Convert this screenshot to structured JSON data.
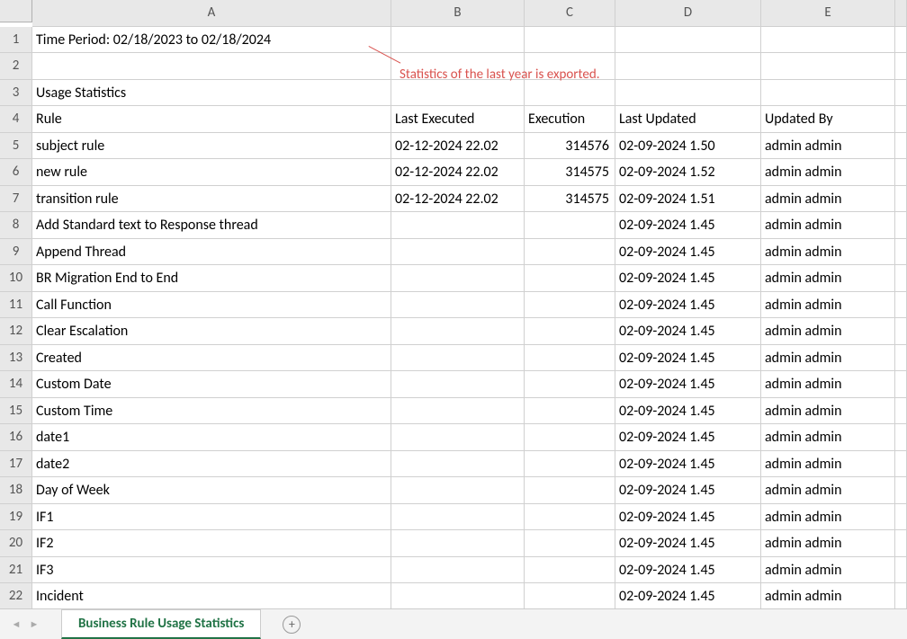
{
  "columns": [
    "A",
    "B",
    "C",
    "D",
    "E"
  ],
  "annotation": "Statistics of the last year is exported.",
  "time_period": "Time Period: 02/18/2023 to 02/18/2024",
  "section_title": "Usage Statistics",
  "headers": {
    "rule": "Rule",
    "last_executed": "Last Executed",
    "execution": "Execution",
    "last_updated": "Last Updated",
    "updated_by": "Updated By"
  },
  "rows": [
    {
      "n": "5",
      "rule": "subject rule",
      "last_executed": "02-12-2024 22.02",
      "execution": "314576",
      "last_updated": "02-09-2024 1.50",
      "updated_by": "admin admin"
    },
    {
      "n": "6",
      "rule": "new rule",
      "last_executed": "02-12-2024 22.02",
      "execution": "314575",
      "last_updated": "02-09-2024 1.52",
      "updated_by": "admin admin"
    },
    {
      "n": "7",
      "rule": "transition rule",
      "last_executed": "02-12-2024 22.02",
      "execution": "314575",
      "last_updated": "02-09-2024 1.51",
      "updated_by": "admin admin"
    },
    {
      "n": "8",
      "rule": "Add Standard text to Response thread",
      "last_executed": "",
      "execution": "",
      "last_updated": "02-09-2024 1.45",
      "updated_by": "admin admin"
    },
    {
      "n": "9",
      "rule": "Append Thread",
      "last_executed": "",
      "execution": "",
      "last_updated": "02-09-2024 1.45",
      "updated_by": "admin admin"
    },
    {
      "n": "10",
      "rule": "BR Migration End to End",
      "last_executed": "",
      "execution": "",
      "last_updated": "02-09-2024 1.45",
      "updated_by": "admin admin"
    },
    {
      "n": "11",
      "rule": "Call Function",
      "last_executed": "",
      "execution": "",
      "last_updated": "02-09-2024 1.45",
      "updated_by": "admin admin"
    },
    {
      "n": "12",
      "rule": "Clear Escalation",
      "last_executed": "",
      "execution": "",
      "last_updated": "02-09-2024 1.45",
      "updated_by": "admin admin"
    },
    {
      "n": "13",
      "rule": "Created",
      "last_executed": "",
      "execution": "",
      "last_updated": "02-09-2024 1.45",
      "updated_by": "admin admin"
    },
    {
      "n": "14",
      "rule": "Custom Date",
      "last_executed": "",
      "execution": "",
      "last_updated": "02-09-2024 1.45",
      "updated_by": "admin admin"
    },
    {
      "n": "15",
      "rule": "Custom Time",
      "last_executed": "",
      "execution": "",
      "last_updated": "02-09-2024 1.45",
      "updated_by": "admin admin"
    },
    {
      "n": "16",
      "rule": "date1",
      "last_executed": "",
      "execution": "",
      "last_updated": "02-09-2024 1.45",
      "updated_by": "admin admin"
    },
    {
      "n": "17",
      "rule": "date2",
      "last_executed": "",
      "execution": "",
      "last_updated": "02-09-2024 1.45",
      "updated_by": "admin admin"
    },
    {
      "n": "18",
      "rule": "Day of Week",
      "last_executed": "",
      "execution": "",
      "last_updated": "02-09-2024 1.45",
      "updated_by": "admin admin"
    },
    {
      "n": "19",
      "rule": "IF1",
      "last_executed": "",
      "execution": "",
      "last_updated": "02-09-2024 1.45",
      "updated_by": "admin admin"
    },
    {
      "n": "20",
      "rule": "IF2",
      "last_executed": "",
      "execution": "",
      "last_updated": "02-09-2024 1.45",
      "updated_by": "admin admin"
    },
    {
      "n": "21",
      "rule": "IF3",
      "last_executed": "",
      "execution": "",
      "last_updated": "02-09-2024 1.45",
      "updated_by": "admin admin"
    },
    {
      "n": "22",
      "rule": "Incident",
      "last_executed": "",
      "execution": "",
      "last_updated": "02-09-2024 1.45",
      "updated_by": "admin admin"
    }
  ],
  "sheet_tab": "Business Rule Usage Statistics",
  "nav_prev": "◄",
  "nav_next": "►",
  "add_icon": "+"
}
